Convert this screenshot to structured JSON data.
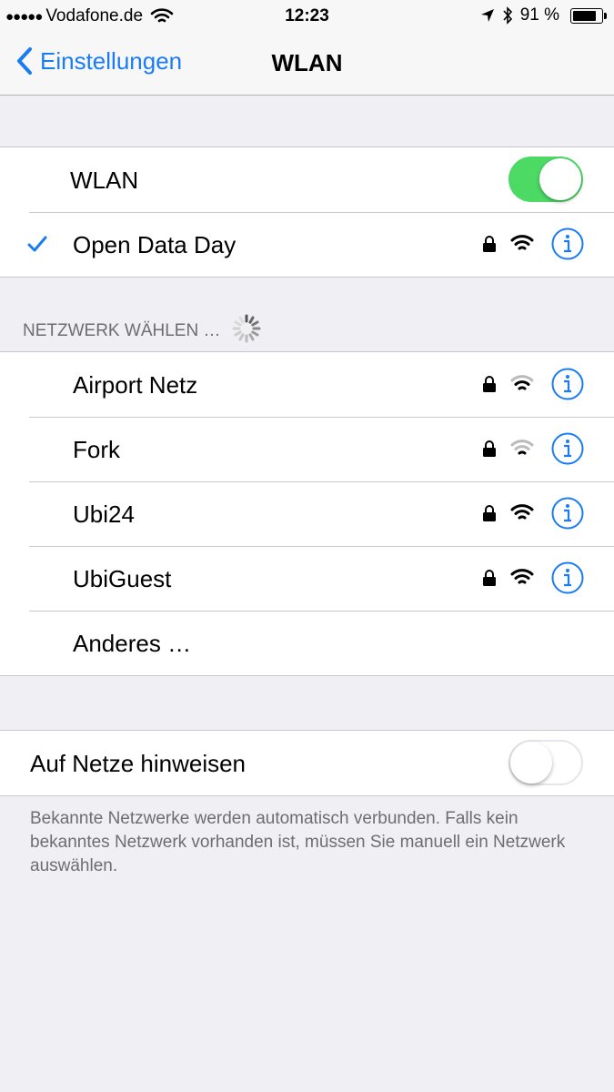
{
  "status_bar": {
    "carrier": "Vodafone.de",
    "time": "12:23",
    "battery": "91 %",
    "battery_level": 0.91
  },
  "nav": {
    "back_label": "Einstellungen",
    "title": "WLAN"
  },
  "wlan_toggle": {
    "label": "WLAN",
    "on": true
  },
  "connected": {
    "name": "Open Data Day",
    "secured": true
  },
  "section_header": "NETZWERK WÄHLEN …",
  "networks": [
    {
      "name": "Airport Netz",
      "secured": true
    },
    {
      "name": "Fork",
      "secured": true
    },
    {
      "name": "Ubi24",
      "secured": true
    },
    {
      "name": "UbiGuest",
      "secured": true
    }
  ],
  "other_label": "Anderes …",
  "ask_to_join": {
    "label": "Auf Netze hinweisen",
    "on": false
  },
  "footer": "Bekannte Netzwerke werden automatisch verbunden. Falls kein bekanntes Netzwerk vorhanden ist, müssen Sie manuell ein Netzwerk auswählen.",
  "colors": {
    "accent": "#1a7cf2",
    "toggle_on": "#4cd964",
    "background": "#efeff4"
  }
}
